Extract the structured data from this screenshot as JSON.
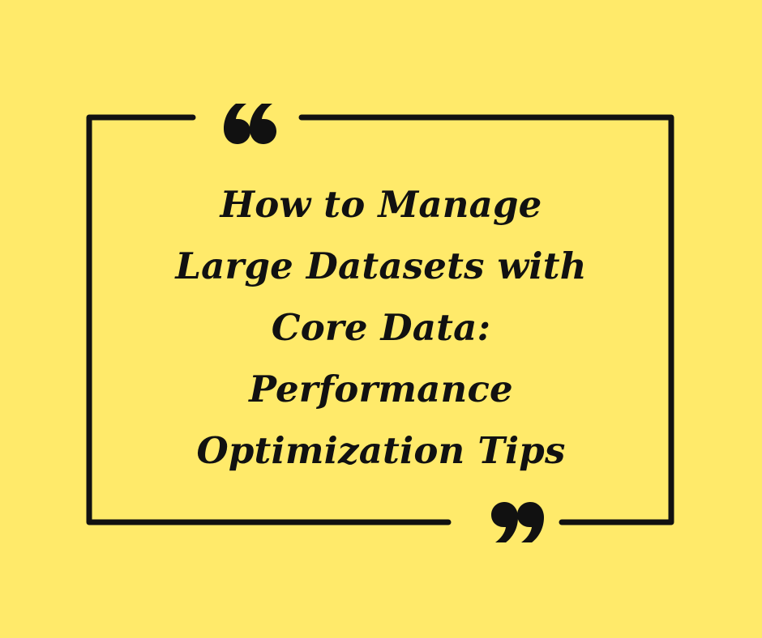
{
  "quote_card": {
    "background_color": "#FFEA6A",
    "frame_color": "#111111",
    "text_color": "#111111",
    "open_quote_icon": "opening-double-quote-mark",
    "close_quote_icon": "closing-double-quote-mark",
    "title_lines": [
      "How to Manage",
      "Large Datasets with",
      "Core Data:",
      "Performance",
      "Optimization Tips"
    ]
  }
}
